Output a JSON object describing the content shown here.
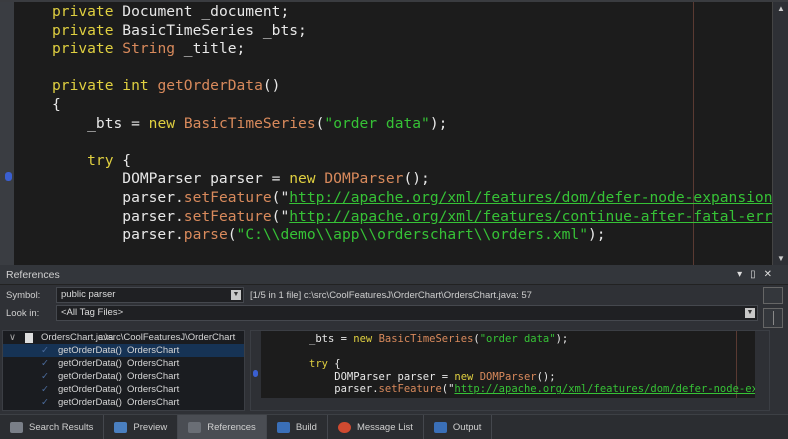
{
  "editor": {
    "lines": [
      [
        [
          "kw",
          "private "
        ],
        [
          "ty",
          "Document _document;"
        ]
      ],
      [
        [
          "kw",
          "private "
        ],
        [
          "ty",
          "BasicTimeSeries _bts;"
        ]
      ],
      [
        [
          "kw",
          "private "
        ],
        [
          "ty2",
          "String"
        ],
        [
          "ty",
          " _title;"
        ]
      ],
      [],
      [
        [
          "kw",
          "private int "
        ],
        [
          "fn",
          "getOrderData"
        ],
        [
          "pl",
          "()"
        ]
      ],
      [
        [
          "pl",
          "{"
        ]
      ],
      [
        [
          "pl",
          "    _bts = "
        ],
        [
          "kw",
          "new "
        ],
        [
          "fn",
          "BasicTimeSeries"
        ],
        [
          "pl",
          "("
        ],
        [
          "str",
          "\"order data\""
        ],
        [
          "pl",
          ");"
        ]
      ],
      [],
      [
        [
          "kw",
          "    try "
        ],
        [
          "pl",
          "{"
        ]
      ],
      [
        [
          "pl",
          "        DOMParser parser = "
        ],
        [
          "kw",
          "new "
        ],
        [
          "fn",
          "DOMParser"
        ],
        [
          "pl",
          "();"
        ]
      ],
      [
        [
          "pl",
          "        parser."
        ],
        [
          "fn",
          "setFeature"
        ],
        [
          "pl",
          "(\""
        ],
        [
          "url",
          "http://apache.org/xml/features/dom/defer-node-expansion"
        ],
        [
          "pl",
          "\","
        ]
      ],
      [
        [
          "pl",
          "        parser."
        ],
        [
          "fn",
          "setFeature"
        ],
        [
          "pl",
          "(\""
        ],
        [
          "url",
          "http://apache.org/xml/features/continue-after-fatal-error"
        ],
        [
          "pl",
          "\""
        ]
      ],
      [
        [
          "pl",
          "        parser."
        ],
        [
          "fn",
          "parse"
        ],
        [
          "pl",
          "("
        ],
        [
          "str",
          "\"C:\\\\demo\\\\app\\\\orderschart\\\\orders.xml\""
        ],
        [
          "pl",
          ");"
        ]
      ]
    ]
  },
  "panel": {
    "title": "References",
    "symbol_label": "Symbol:",
    "symbol_value": "public  parser",
    "location_info": "[1/5 in 1 file] c:\\src\\CoolFeaturesJ\\OrderChart\\OrdersChart.java: 57",
    "lookin_label": "Look in:",
    "lookin_value": "<All Tag Files>",
    "tree": {
      "file": "OrdersChart.java",
      "path": "c:\\src\\CoolFeaturesJ\\OrderChart",
      "items": [
        {
          "fn": "getOrderData()",
          "cls": "OrdersChart"
        },
        {
          "fn": "getOrderData()",
          "cls": "OrdersChart"
        },
        {
          "fn": "getOrderData()",
          "cls": "OrdersChart"
        },
        {
          "fn": "getOrderData()",
          "cls": "OrdersChart"
        },
        {
          "fn": "getOrderData()",
          "cls": "OrdersChart"
        }
      ]
    },
    "preview": {
      "lines": [
        [
          [
            "pl",
            "_bts = "
          ],
          [
            "kw",
            "new "
          ],
          [
            "fn",
            "BasicTimeSeries"
          ],
          [
            "pl",
            "("
          ],
          [
            "str",
            "\"order data\""
          ],
          [
            "pl",
            ");"
          ]
        ],
        [],
        [
          [
            "kw",
            "try "
          ],
          [
            "pl",
            "{"
          ]
        ],
        [
          [
            "pl",
            "    DOMParser parser = "
          ],
          [
            "kw",
            "new "
          ],
          [
            "fn",
            "DOMParser"
          ],
          [
            "pl",
            "();"
          ]
        ],
        [
          [
            "pl",
            "    parser."
          ],
          [
            "fn",
            "setFeature"
          ],
          [
            "pl",
            "(\""
          ],
          [
            "url",
            "http://apache.org/xml/features/dom/defer-node-expansion"
          ]
        ]
      ]
    }
  },
  "tabs": [
    {
      "label": "Search Results",
      "color": "#7a7f88"
    },
    {
      "label": "Preview",
      "color": "#4a7fc0"
    },
    {
      "label": "References",
      "color": "#6a6e75",
      "active": true
    },
    {
      "label": "Build",
      "color": "#3a6fb8"
    },
    {
      "label": "Message List",
      "color": "#d04a30"
    },
    {
      "label": "Output",
      "color": "#3a6fb8"
    }
  ]
}
